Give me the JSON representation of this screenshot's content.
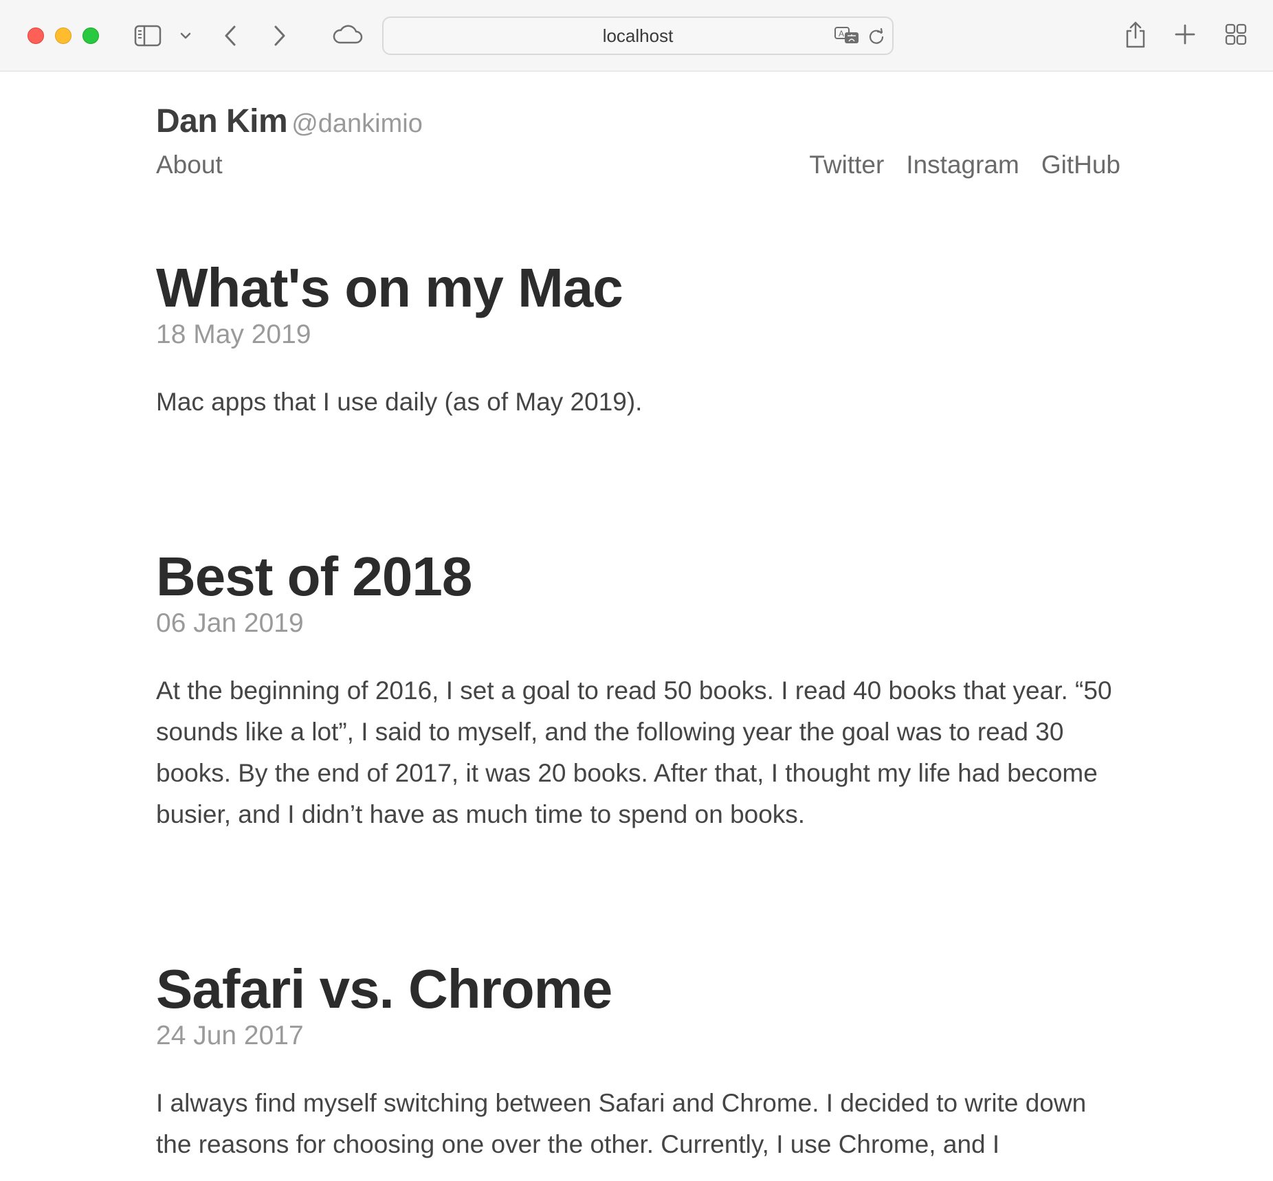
{
  "browser": {
    "address": "localhost"
  },
  "site": {
    "name": "Dan Kim",
    "handle": "@dankimio",
    "nav_left": "About",
    "nav_right": [
      "Twitter",
      "Instagram",
      "GitHub"
    ]
  },
  "posts": [
    {
      "title": "What's on my Mac",
      "date": "18 May 2019",
      "excerpt": "Mac apps that I use daily (as of May 2019)."
    },
    {
      "title": "Best of 2018",
      "date": "06 Jan 2019",
      "excerpt": "At the beginning of 2016, I set a goal to read 50 books. I read 40 books that year. “50 sounds like a lot”, I said to myself, and the following year the goal was to read 30 books. By the end of 2017, it was 20 books. After that, I thought my life had become busier, and I didn’t have as much time to spend on books."
    },
    {
      "title": "Safari vs. Chrome",
      "date": "24 Jun 2017",
      "excerpt": "I always find myself switching between Safari and Chrome. I decided to write down the reasons for choosing one over the other. Currently, I use Chrome, and I"
    }
  ]
}
